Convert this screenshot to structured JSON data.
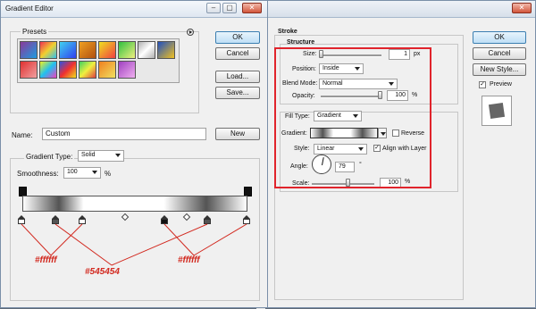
{
  "colors": {
    "annotation_red": "#d2281e",
    "stop_dark": "#545454",
    "stop_light": "#ffffff"
  },
  "gradient_editor": {
    "title": "Gradient Editor",
    "buttons": {
      "ok": "OK",
      "cancel": "Cancel",
      "load": "Load...",
      "save": "Save...",
      "new": "New"
    },
    "presets": {
      "label": "Presets",
      "menu_icon": "play-circle-icon"
    },
    "name": {
      "label": "Name:",
      "value": "Custom"
    },
    "gradient_type": {
      "label": "Gradient Type:",
      "value": "Solid"
    },
    "smoothness": {
      "label": "Smoothness:",
      "value": "100",
      "unit": "%"
    },
    "annotations": [
      "#ffffff",
      "#545454",
      "#ffffff"
    ]
  },
  "layer_style": {
    "buttons": {
      "ok": "OK",
      "cancel": "Cancel",
      "new_style": "New Style...",
      "preview": "Preview"
    },
    "stroke": {
      "title": "Stroke",
      "structure": {
        "title": "Structure",
        "size": {
          "label": "Size:",
          "value": "1",
          "unit": "px"
        },
        "position": {
          "label": "Position:",
          "value": "Inside"
        },
        "blend_mode": {
          "label": "Blend Mode:",
          "value": "Normal"
        },
        "opacity": {
          "label": "Opacity:",
          "value": "100",
          "unit": "%"
        }
      },
      "fill_type": {
        "label": "Fill Type:",
        "value": "Gradient"
      },
      "gradient": {
        "label": "Gradient:",
        "reverse": "Reverse"
      },
      "style": {
        "label": "Style:",
        "value": "Linear",
        "align_label": "Align with Layer"
      },
      "angle": {
        "label": "Angle:",
        "value": "79",
        "unit": "°"
      },
      "scale": {
        "label": "Scale:",
        "value": "100",
        "unit": "%"
      }
    }
  }
}
